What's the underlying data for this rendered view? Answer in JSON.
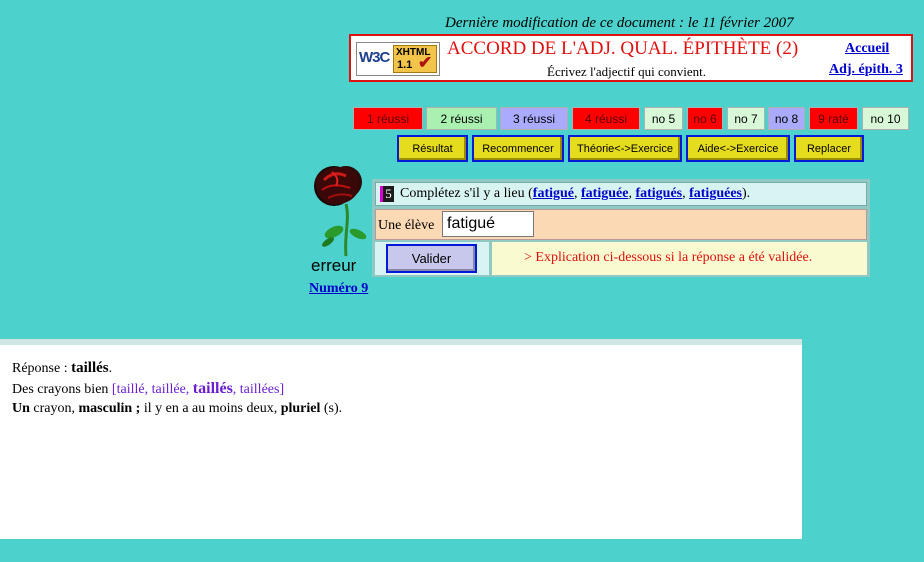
{
  "header": {
    "last_modified": "Dernière modification de ce document : le 11 février 2007",
    "badge_w3c": "W3C",
    "badge_xhtml": "XHTML",
    "badge_version": "1.1",
    "title": "ACCORD DE L'ADJ. QUAL. ÉPITHÈTE (2)",
    "subtitle": "Écrivez l'adjectif qui convient.",
    "link_accueil": "Accueil",
    "link_adj": "Adj. épith. 3"
  },
  "score_cells": [
    {
      "label": "1 réussi",
      "state": "red"
    },
    {
      "label": "2 réussi",
      "state": "green"
    },
    {
      "label": "3 réussi",
      "state": "blue"
    },
    {
      "label": "4 réussi",
      "state": "red"
    },
    {
      "label": "no 5",
      "state": "pale"
    },
    {
      "label": "no 6",
      "state": "red"
    },
    {
      "label": "no 7",
      "state": "pale"
    },
    {
      "label": "no 8",
      "state": "blue"
    },
    {
      "label": "9 raté",
      "state": "red"
    },
    {
      "label": "no 10",
      "state": "pale"
    }
  ],
  "toolbar": {
    "resultat": "Résultat",
    "recommencer": "Recommencer",
    "theorie": "Théorie<->Exercice",
    "aide": "Aide<->Exercice",
    "replacer": "Replacer"
  },
  "status": {
    "result": "erreur",
    "numero": "Numéro 9"
  },
  "exercise": {
    "number": "5",
    "instruction": "Complétez s'il y a lieu (",
    "options": [
      "fatigué",
      "fatiguée",
      "fatigués",
      "fatiguées"
    ],
    "prompt": "Une élève",
    "answer_value": "fatigué",
    "validate_label": "Valider",
    "explanation": "> Explication ci-dessous si la réponse a été validée."
  },
  "answer": {
    "line1_label": "Réponse : ",
    "line1_value": "taillés",
    "line2_start": "Des crayons bien ",
    "line2_options": [
      "taillé",
      "taillée",
      "taillés",
      "taillées"
    ],
    "line3_un": "Un",
    "line3_a": " crayon, ",
    "line3_masc": "masculin ;",
    "line3_b": " il y en a au moins deux, ",
    "line3_pluriel": "pluriel",
    "line3_c": " (s)."
  },
  "colors": {
    "background": "#4cd1cc",
    "title": "#e01010",
    "link": "#0000cc",
    "button": "#e6dc1e"
  }
}
